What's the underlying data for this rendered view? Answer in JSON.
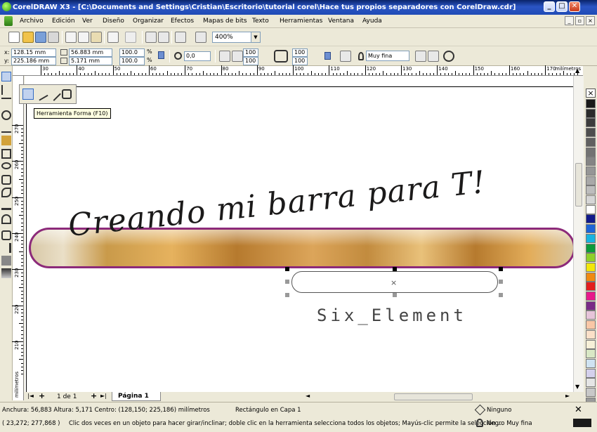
{
  "window": {
    "title": "CorelDRAW X3 - [C:\\Documents and Settings\\Cristian\\Escritorio\\tutorial corel\\Hace tus propios separadores con CorelDraw.cdr]",
    "minimize": "_",
    "maximize": "□",
    "close": "✕"
  },
  "menu": [
    "Archivo",
    "Edición",
    "Ver",
    "Diseño",
    "Organizar",
    "Efectos",
    "Mapas de bits",
    "Texto",
    "Herramientas",
    "Ventana",
    "Ayuda"
  ],
  "mdi": {
    "minimize": "_",
    "restore": "▫",
    "close": "×"
  },
  "toolbar": {
    "zoom": "400%"
  },
  "propbar": {
    "x_label": "x:",
    "x": "128.15 mm",
    "y_label": "y:",
    "y": "225.186 mm",
    "width": "56.883 mm",
    "height": "5.171 mm",
    "scale_w": "100.0",
    "scale_h": "100.0",
    "pct1": "%",
    "pct2": "%",
    "angle": "0,0",
    "corner_tl": "100",
    "corner_bl": "100",
    "corner_tr": "100",
    "corner_br": "100",
    "outline": "Muy fina"
  },
  "ruler": {
    "h_ticks": [
      "30",
      "40",
      "50",
      "60",
      "70",
      "80",
      "90",
      "100",
      "110",
      "120",
      "130",
      "140",
      "150",
      "160",
      "170"
    ],
    "h_unit": "milímetros",
    "v_ticks": [
      "270",
      "260",
      "250",
      "240",
      "230",
      "220",
      "210"
    ],
    "v_unit": "milímetros"
  },
  "tooltip": "Herramienta Forma (F10)",
  "canvas": {
    "banner_text": "Creando mi barra para T!",
    "watermark": "Six_Element",
    "center_mark": "×"
  },
  "pagenav": {
    "counter": "1 de 1",
    "page_tab": "Página 1"
  },
  "palette": [
    "#1a1a1a",
    "#2b2b2b",
    "#3c3c3c",
    "#4e4e4e",
    "#606060",
    "#727272",
    "#848484",
    "#969696",
    "#a8a8a8",
    "#bdbdbd",
    "#d6d6d6",
    "#ffffff",
    "#111a8a",
    "#1e64d6",
    "#19b3e0",
    "#0c9a3a",
    "#8fcf2a",
    "#f2e60a",
    "#f08a12",
    "#e31d1d",
    "#e8198b",
    "#7a2a87",
    "#e6c4d9",
    "#f9c7a6",
    "#fbe0c8",
    "#f7f0d8",
    "#d9e8c5",
    "#cfe3f2",
    "#d4d0ec",
    "#e5e5e5",
    "#c8c8c8",
    "#9a9a9a",
    "#6a5f8f",
    "#3b3b5a"
  ],
  "status": {
    "dimensions": "Anchura: 56,883  Altura: 5,171   Centro: (128,150; 225,186)   milímetros",
    "object_info": "Rectángulo en Capa 1",
    "fill": "Ninguno",
    "coords": "( 23,272; 277,868 )",
    "hint": "Clic dos veces en un objeto para hacer girar/inclinar; doble clic en la herramienta selecciona todos los objetos; Mayús-clic permite la selección ...",
    "outline": "Negro  Muy fina"
  }
}
